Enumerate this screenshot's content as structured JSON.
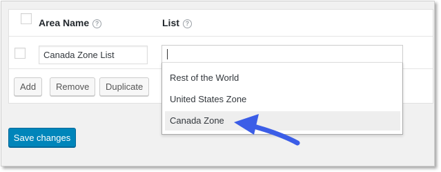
{
  "table": {
    "headers": {
      "area_name": "Area Name",
      "list": "List"
    },
    "help_glyph": "?",
    "row": {
      "area_name_value": "Canada Zone List"
    }
  },
  "buttons": {
    "add": "Add",
    "remove": "Remove",
    "duplicate": "Duplicate"
  },
  "dropdown": {
    "options": [
      "Rest of the World",
      "United States Zone",
      "Canada Zone"
    ],
    "highlighted": "Canada Zone"
  },
  "save_label": "Save changes",
  "colors": {
    "primary": "#0085ba",
    "annotation_arrow": "#3b5de7"
  }
}
